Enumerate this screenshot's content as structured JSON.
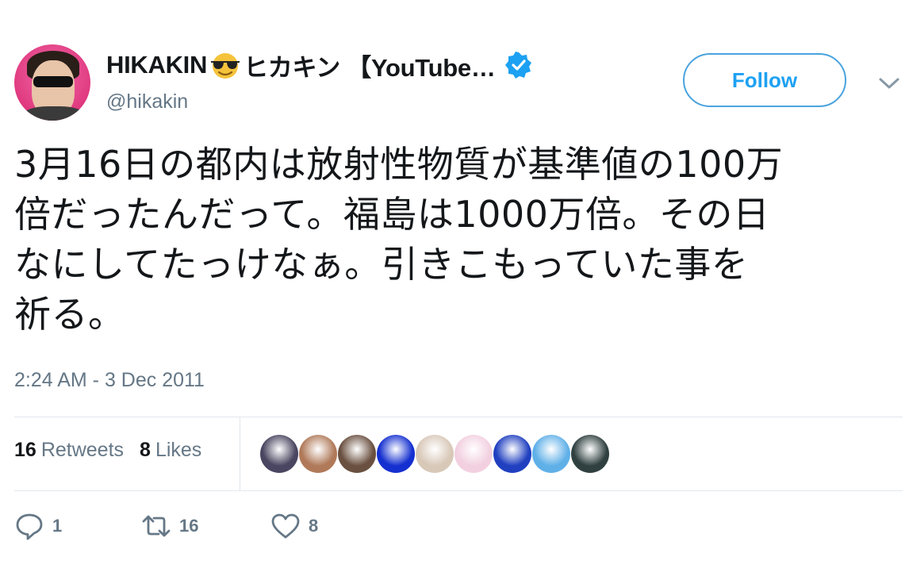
{
  "author": {
    "display_name": "HIKAKIN",
    "display_name_suffix": "ヒカキン 【YouTube…",
    "handle": "@hikakin",
    "emoji_icon": "smiling-face-with-sunglasses-icon",
    "verified_icon": "verified-badge-icon",
    "avatar_color": "#e0397f"
  },
  "follow_label": "Follow",
  "tweet": {
    "lines": [
      "3月16日の都内は放射性物質が基準値の100万",
      "倍だったんだって。福島は1000万倍。その日",
      "なにしてたっけなぁ。引きこもっていた事を",
      "祈る。"
    ]
  },
  "timestamp": "2:24 AM - 3 Dec 2011",
  "stats": {
    "retweets_count": "16",
    "retweets_label": "Retweets",
    "likes_count": "8",
    "likes_label": "Likes"
  },
  "liker_avatar_colors": [
    "#4a4560",
    "#b07a5a",
    "#6a5040",
    "#1530d0",
    "#d8c8b8",
    "#f2d0e0",
    "#2040c0",
    "#60b0e8",
    "#304040"
  ],
  "actions": {
    "reply_count": "1",
    "retweet_count": "16",
    "like_count": "8"
  },
  "colors": {
    "accent": "#1da1f2",
    "secondary_text": "#657786",
    "divider": "#e1e8ed"
  }
}
